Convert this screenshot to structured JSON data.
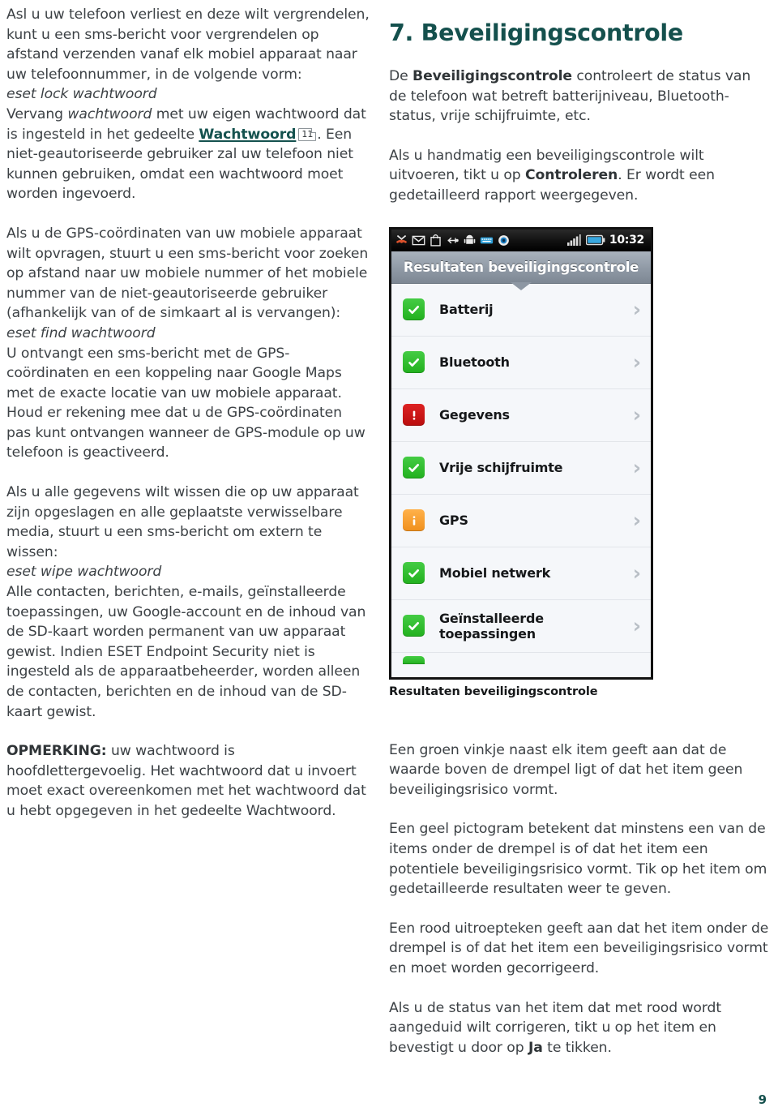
{
  "document": {
    "page_number": "9"
  },
  "left_column": {
    "para1": {
      "line_a": "Asl u uw telefoon verliest en deze wilt vergrendelen, kunt u een sms-bericht voor vergrendelen op afstand verzenden vanaf elk mobiel apparaat naar uw telefoonnummer, in de volgende vorm:",
      "command": "eset lock wachtwoord",
      "after_a": "Vervang ",
      "emph_a": "wachtwoord",
      "after_b": " met uw eigen wachtwoord dat is ingesteld in het gedeelte ",
      "link": "Wachtwoord",
      "pageref": "11",
      "after_c": ". Een niet-geautoriseerde gebruiker zal uw telefoon niet kunnen gebruiken, omdat een wachtwoord moet worden ingevoerd."
    },
    "para2": {
      "intro": "Als u de GPS-coördinaten van uw mobiele apparaat wilt opvragen, stuurt u een sms-bericht voor zoeken op afstand naar uw mobiele nummer of het mobiele nummer van de niet-geautoriseerde gebruiker (afhankelijk van of de simkaart al is vervangen):",
      "command": "eset find wachtwoord",
      "body": "U ontvangt een sms-bericht met de GPS-coördinaten en een koppeling naar Google Maps met de exacte locatie van uw mobiele apparaat. Houd er rekening mee dat u de GPS-coördinaten pas kunt ontvangen wanneer de GPS-module op uw telefoon is geactiveerd."
    },
    "para3": {
      "intro": "Als u alle gegevens wilt wissen die op uw apparaat zijn opgeslagen en alle geplaatste verwisselbare media, stuurt u een sms-bericht om extern te wissen:",
      "command": "eset wipe wachtwoord",
      "body": "Alle contacten, berichten, e-mails, geïnstalleerde toepassingen, uw Google-account en de inhoud van de SD-kaart worden permanent van uw apparaat gewist. Indien ESET Endpoint Security niet is ingesteld als de apparaatbeheerder, worden alleen de contacten, berichten en de inhoud van de SD-kaart gewist."
    },
    "note": {
      "label": "OPMERKING:",
      "text": " uw wachtwoord is hoofdlettergevoelig. Het wachtwoord dat u invoert moet exact overeenkomen met het wachtwoord dat u hebt opgegeven in het gedeelte Wachtwoord."
    }
  },
  "right_column": {
    "heading": "7. Beveiligingscontrole",
    "para1": {
      "before": "De ",
      "bold": "Beveiligingscontrole",
      "after": " controleert de status van de telefoon wat betreft batterijniveau, Bluetooth-status, vrije schijfruimte, etc."
    },
    "para2": {
      "before": "Als u handmatig een beveiligingscontrole wilt uitvoeren, tikt u op ",
      "bold": "Controleren",
      "after": ". Er wordt een gedetailleerd rapport weergegeven."
    },
    "screenshot": {
      "statusbar": {
        "clock": "10:32",
        "icons": [
          "missed-call-icon",
          "gmail-icon",
          "market-bag-icon",
          "usb-icon",
          "android-icon",
          "keyboard-icon",
          "eye-icon"
        ],
        "right_icons": [
          "signal-bars-icon",
          "battery-icon"
        ]
      },
      "title": "Resultaten beveiligingscontrole",
      "rows": [
        {
          "label": "Batterij",
          "status": "ok"
        },
        {
          "label": "Bluetooth",
          "status": "ok"
        },
        {
          "label": "Gegevens",
          "status": "err"
        },
        {
          "label": "Vrije schijfruimte",
          "status": "ok"
        },
        {
          "label": "GPS",
          "status": "warn"
        },
        {
          "label": "Mobiel netwerk",
          "status": "ok"
        },
        {
          "label": "Geïnstalleerde toepassingen",
          "status": "ok"
        }
      ],
      "caption": "Resultaten beveiligingscontrole"
    },
    "para3": "Een groen vinkje naast elk item geeft aan dat de waarde boven de drempel ligt of dat het item geen beveiligingsrisico vormt.",
    "para4": "Een geel pictogram betekent dat minstens een van de items onder de drempel is of dat het item een potentiele beveiligingsrisico vormt. Tik op het item om gedetailleerde resultaten weer te geven.",
    "para5": "Een rood uitroepteken geeft aan dat het item onder de drempel is of dat het item een beveiligingsrisico vormt en moet worden gecorrigeerd.",
    "para6": {
      "before": "Als u de status van het item dat met rood wordt aangeduid wilt corrigeren, tikt u op het item en bevestigt u door op ",
      "bold": "Ja",
      "after": " te tikken."
    }
  },
  "colors": {
    "heading": "#14504d",
    "link": "#15524f",
    "body_text": "#3c4145",
    "status_ok": "#2db32a",
    "status_err": "#c41414",
    "status_warn": "#f5a22b"
  }
}
